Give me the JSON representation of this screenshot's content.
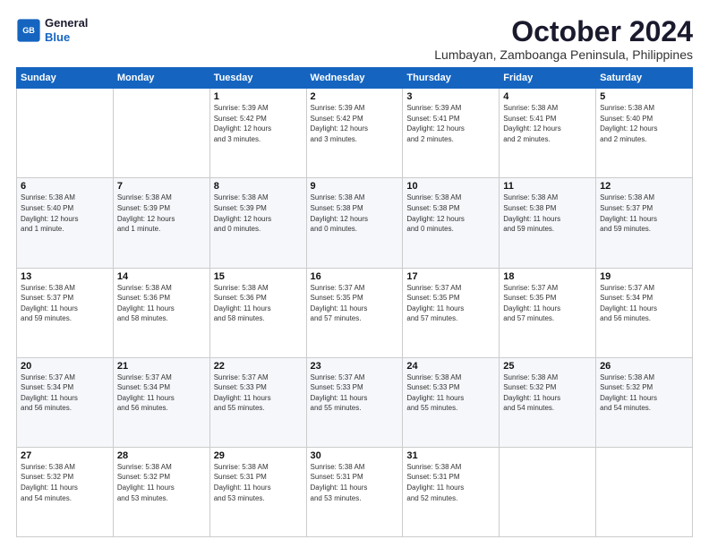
{
  "logo": {
    "line1": "General",
    "line2": "Blue"
  },
  "title": "October 2024",
  "location": "Lumbayan, Zamboanga Peninsula, Philippines",
  "weekdays": [
    "Sunday",
    "Monday",
    "Tuesday",
    "Wednesday",
    "Thursday",
    "Friday",
    "Saturday"
  ],
  "weeks": [
    [
      {
        "day": "",
        "info": ""
      },
      {
        "day": "",
        "info": ""
      },
      {
        "day": "1",
        "info": "Sunrise: 5:39 AM\nSunset: 5:42 PM\nDaylight: 12 hours\nand 3 minutes."
      },
      {
        "day": "2",
        "info": "Sunrise: 5:39 AM\nSunset: 5:42 PM\nDaylight: 12 hours\nand 3 minutes."
      },
      {
        "day": "3",
        "info": "Sunrise: 5:39 AM\nSunset: 5:41 PM\nDaylight: 12 hours\nand 2 minutes."
      },
      {
        "day": "4",
        "info": "Sunrise: 5:38 AM\nSunset: 5:41 PM\nDaylight: 12 hours\nand 2 minutes."
      },
      {
        "day": "5",
        "info": "Sunrise: 5:38 AM\nSunset: 5:40 PM\nDaylight: 12 hours\nand 2 minutes."
      }
    ],
    [
      {
        "day": "6",
        "info": "Sunrise: 5:38 AM\nSunset: 5:40 PM\nDaylight: 12 hours\nand 1 minute."
      },
      {
        "day": "7",
        "info": "Sunrise: 5:38 AM\nSunset: 5:39 PM\nDaylight: 12 hours\nand 1 minute."
      },
      {
        "day": "8",
        "info": "Sunrise: 5:38 AM\nSunset: 5:39 PM\nDaylight: 12 hours\nand 0 minutes."
      },
      {
        "day": "9",
        "info": "Sunrise: 5:38 AM\nSunset: 5:38 PM\nDaylight: 12 hours\nand 0 minutes."
      },
      {
        "day": "10",
        "info": "Sunrise: 5:38 AM\nSunset: 5:38 PM\nDaylight: 12 hours\nand 0 minutes."
      },
      {
        "day": "11",
        "info": "Sunrise: 5:38 AM\nSunset: 5:38 PM\nDaylight: 11 hours\nand 59 minutes."
      },
      {
        "day": "12",
        "info": "Sunrise: 5:38 AM\nSunset: 5:37 PM\nDaylight: 11 hours\nand 59 minutes."
      }
    ],
    [
      {
        "day": "13",
        "info": "Sunrise: 5:38 AM\nSunset: 5:37 PM\nDaylight: 11 hours\nand 59 minutes."
      },
      {
        "day": "14",
        "info": "Sunrise: 5:38 AM\nSunset: 5:36 PM\nDaylight: 11 hours\nand 58 minutes."
      },
      {
        "day": "15",
        "info": "Sunrise: 5:38 AM\nSunset: 5:36 PM\nDaylight: 11 hours\nand 58 minutes."
      },
      {
        "day": "16",
        "info": "Sunrise: 5:37 AM\nSunset: 5:35 PM\nDaylight: 11 hours\nand 57 minutes."
      },
      {
        "day": "17",
        "info": "Sunrise: 5:37 AM\nSunset: 5:35 PM\nDaylight: 11 hours\nand 57 minutes."
      },
      {
        "day": "18",
        "info": "Sunrise: 5:37 AM\nSunset: 5:35 PM\nDaylight: 11 hours\nand 57 minutes."
      },
      {
        "day": "19",
        "info": "Sunrise: 5:37 AM\nSunset: 5:34 PM\nDaylight: 11 hours\nand 56 minutes."
      }
    ],
    [
      {
        "day": "20",
        "info": "Sunrise: 5:37 AM\nSunset: 5:34 PM\nDaylight: 11 hours\nand 56 minutes."
      },
      {
        "day": "21",
        "info": "Sunrise: 5:37 AM\nSunset: 5:34 PM\nDaylight: 11 hours\nand 56 minutes."
      },
      {
        "day": "22",
        "info": "Sunrise: 5:37 AM\nSunset: 5:33 PM\nDaylight: 11 hours\nand 55 minutes."
      },
      {
        "day": "23",
        "info": "Sunrise: 5:37 AM\nSunset: 5:33 PM\nDaylight: 11 hours\nand 55 minutes."
      },
      {
        "day": "24",
        "info": "Sunrise: 5:38 AM\nSunset: 5:33 PM\nDaylight: 11 hours\nand 55 minutes."
      },
      {
        "day": "25",
        "info": "Sunrise: 5:38 AM\nSunset: 5:32 PM\nDaylight: 11 hours\nand 54 minutes."
      },
      {
        "day": "26",
        "info": "Sunrise: 5:38 AM\nSunset: 5:32 PM\nDaylight: 11 hours\nand 54 minutes."
      }
    ],
    [
      {
        "day": "27",
        "info": "Sunrise: 5:38 AM\nSunset: 5:32 PM\nDaylight: 11 hours\nand 54 minutes."
      },
      {
        "day": "28",
        "info": "Sunrise: 5:38 AM\nSunset: 5:32 PM\nDaylight: 11 hours\nand 53 minutes."
      },
      {
        "day": "29",
        "info": "Sunrise: 5:38 AM\nSunset: 5:31 PM\nDaylight: 11 hours\nand 53 minutes."
      },
      {
        "day": "30",
        "info": "Sunrise: 5:38 AM\nSunset: 5:31 PM\nDaylight: 11 hours\nand 53 minutes."
      },
      {
        "day": "31",
        "info": "Sunrise: 5:38 AM\nSunset: 5:31 PM\nDaylight: 11 hours\nand 52 minutes."
      },
      {
        "day": "",
        "info": ""
      },
      {
        "day": "",
        "info": ""
      }
    ]
  ]
}
